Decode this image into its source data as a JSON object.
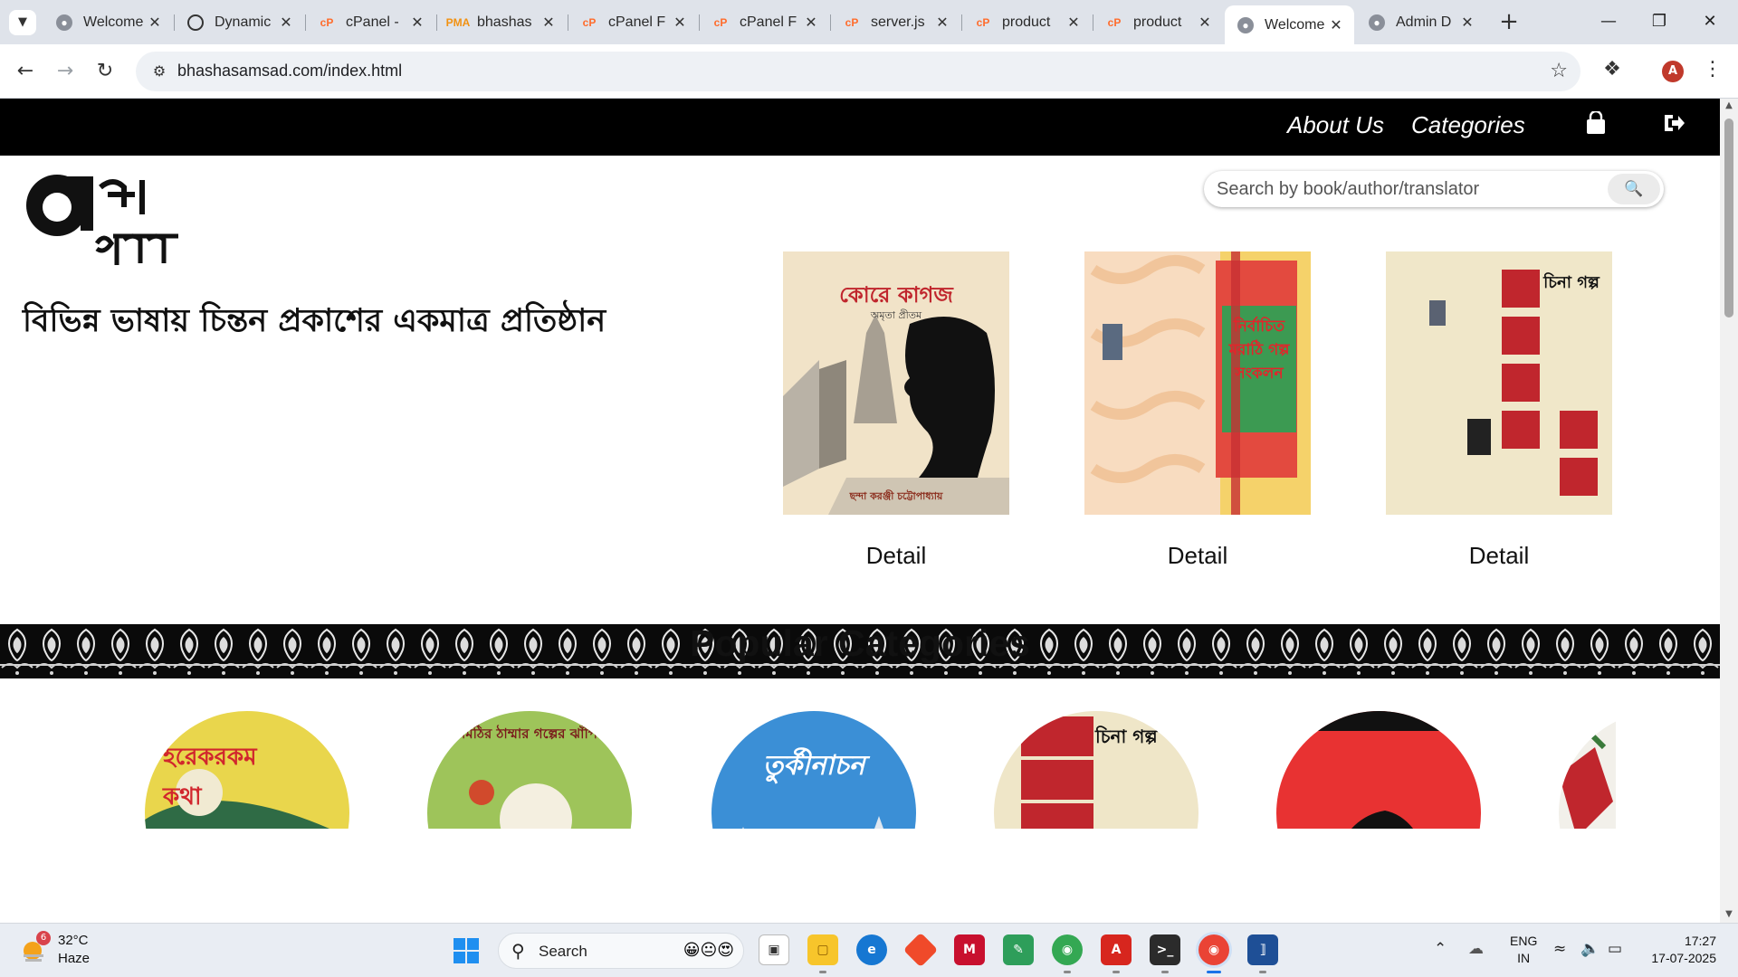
{
  "browser": {
    "tabs": [
      {
        "title": "Welcome",
        "favicon": "globe-icon"
      },
      {
        "title": "Dynamic",
        "favicon": "spiral-icon"
      },
      {
        "title": "cPanel -",
        "favicon": "cpanel-icon"
      },
      {
        "title": "bhashas",
        "favicon": "phpmyadmin-icon"
      },
      {
        "title": "cPanel F",
        "favicon": "cpanel-icon"
      },
      {
        "title": "cPanel F",
        "favicon": "cpanel-icon"
      },
      {
        "title": "server.js",
        "favicon": "cpanel-icon"
      },
      {
        "title": "product",
        "favicon": "cpanel-icon"
      },
      {
        "title": "product",
        "favicon": "cpanel-icon"
      },
      {
        "title": "Welcome",
        "favicon": "globe-icon",
        "active": true
      },
      {
        "title": "Admin D",
        "favicon": "globe-icon"
      }
    ],
    "url": "bhashasamsad.com/index.html",
    "profile_initial": "A",
    "accent_color": "#dfe3ea"
  },
  "site": {
    "nav": {
      "about": "About Us",
      "categories": "Categories"
    },
    "logo_alt": "ভাষা সংসদ",
    "tagline": "বিভিন্ন ভাষায় চিন্তন প্রকাশের একমাত্র প্রতিষ্ঠান",
    "search": {
      "placeholder": "Search by book/author/translator"
    },
    "featured_books": [
      {
        "cover_title": "কোরে কাগজ",
        "cover_author": "অমৃতা প্রীতম",
        "cover_translator": "ছন্দা করঞ্জী চট্টোপাধ্যায়",
        "detail_label": "Detail"
      },
      {
        "cover_title": "নির্বাচিত মরাঠি গল্প সংকলন",
        "detail_label": "Detail"
      },
      {
        "cover_title": "চিনা গল্প",
        "detail_label": "Detail"
      }
    ],
    "popular_categories_title": "Popular Categories",
    "categories": [
      {
        "cover_text": "হরেকরকম কথা",
        "color": "#e8d84a"
      },
      {
        "cover_text": "মিঠির ঠাম্মার গল্পের ঝাঁপি",
        "color": "#9ec45a"
      },
      {
        "cover_text": "তুর্কীনাচন",
        "color": "#3b8fd6"
      },
      {
        "cover_text": "চিনা গল্প",
        "color": "#efe6c8"
      },
      {
        "cover_text": "",
        "color": "#e83232"
      },
      {
        "cover_text": "",
        "color": "#f2f0ea"
      }
    ]
  },
  "taskbar": {
    "weather": {
      "temp": "32°C",
      "condition": "Haze",
      "badge": "6"
    },
    "search_label": "Search",
    "language": [
      "ENG",
      "IN"
    ],
    "time": "17:27",
    "date": "17-07-2025"
  }
}
